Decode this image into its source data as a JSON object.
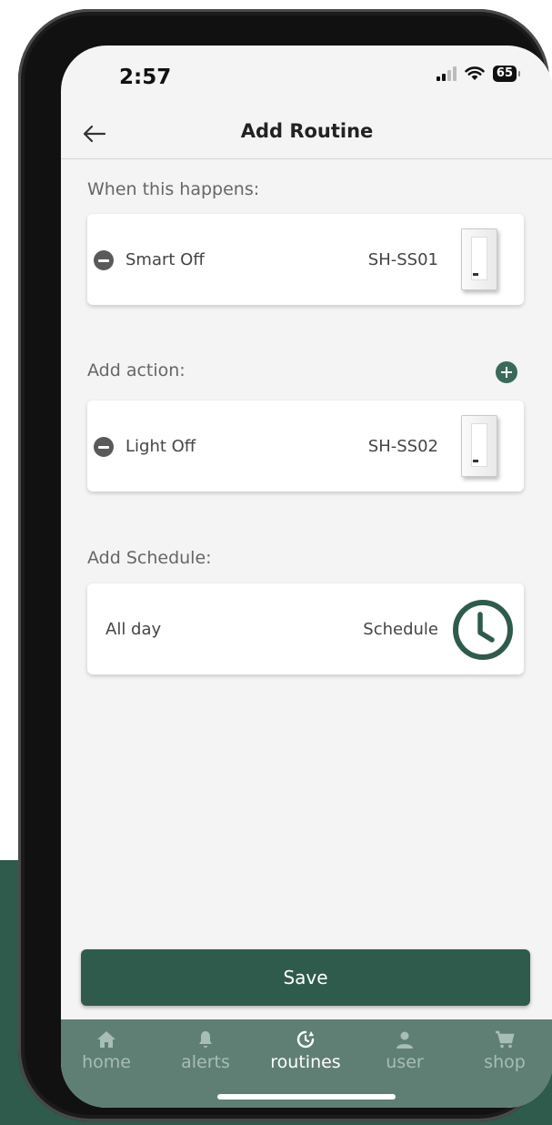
{
  "status_bar": {
    "time": "2:57",
    "battery": "65"
  },
  "header": {
    "title": "Add Routine"
  },
  "trigger": {
    "label": "When this happens:",
    "item": {
      "name": "Smart Off",
      "code": "SH-SS01"
    }
  },
  "action": {
    "label": "Add action:",
    "item": {
      "name": "Light Off",
      "code": "SH-SS02"
    }
  },
  "schedule": {
    "label": "Add Schedule:",
    "item": {
      "value": "All day",
      "button_label": "Schedule"
    }
  },
  "save_label": "Save",
  "tabs": [
    {
      "label": "home",
      "icon": "home-icon",
      "active": false
    },
    {
      "label": "alerts",
      "icon": "bell-icon",
      "active": false
    },
    {
      "label": "routines",
      "icon": "routine-clock-icon",
      "active": true
    },
    {
      "label": "user",
      "icon": "user-icon",
      "active": false
    },
    {
      "label": "shop",
      "icon": "cart-icon",
      "active": false
    }
  ],
  "colors": {
    "primary": "#2f5b4c",
    "tabbar": "#5f7f74",
    "background": "#f4f4f4"
  }
}
